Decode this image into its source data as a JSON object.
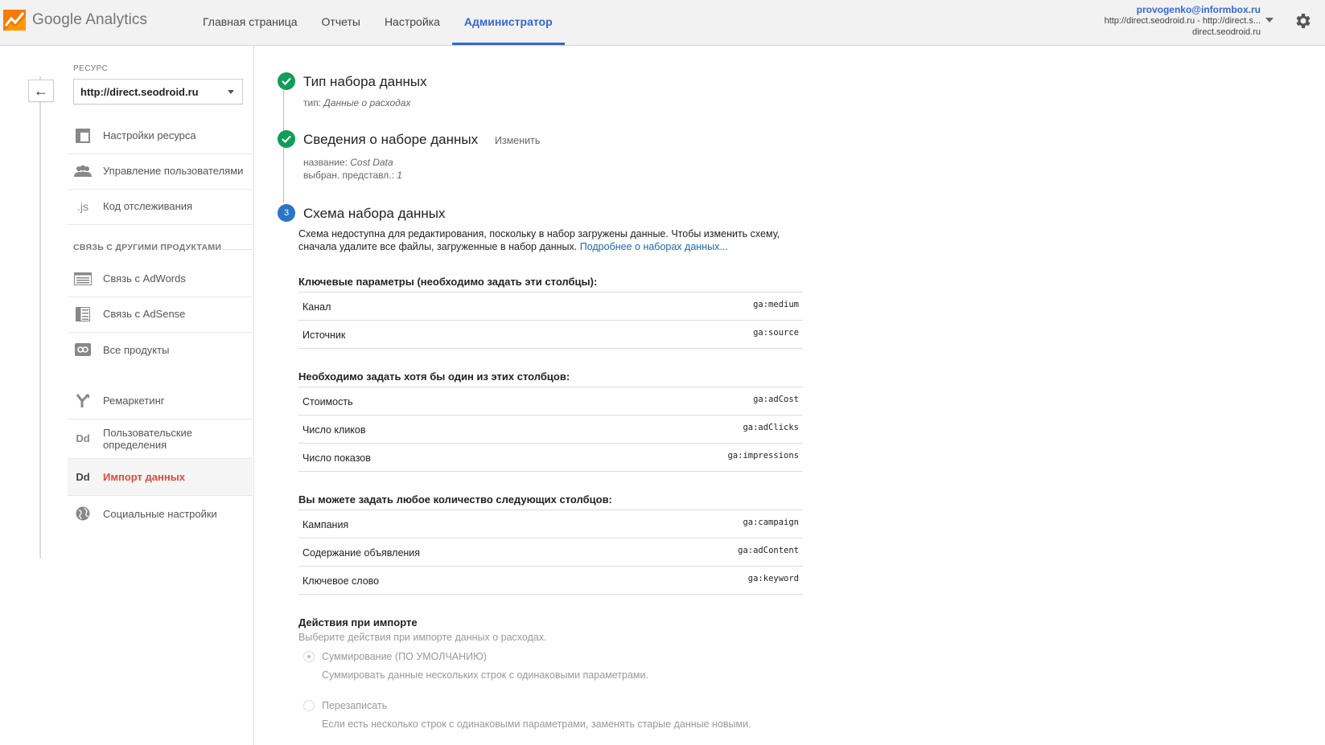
{
  "header": {
    "logo_text": "Google Analytics",
    "nav": [
      {
        "label": "Главная страница",
        "active": false
      },
      {
        "label": "Отчеты",
        "active": false
      },
      {
        "label": "Настройка",
        "active": false
      },
      {
        "label": "Администратор",
        "active": true
      }
    ],
    "account": {
      "email": "provogenko@informbox.ru",
      "property_line": "http://direct.seodroid.ru - http://direct.s...",
      "view_line": "direct.seodroid.ru"
    }
  },
  "sidebar": {
    "resource_label": "РЕСУРС",
    "resource_value": "http://direct.seodroid.ru",
    "items": [
      {
        "label": "Настройки ресурса",
        "icon": "property-settings-icon"
      },
      {
        "label": "Управление пользователями",
        "icon": "users-icon"
      },
      {
        "label": "Код отслеживания",
        "icon": "js-icon"
      }
    ],
    "section_label": "СВЯЗЬ С ДРУГИМИ ПРОДУКТАМИ",
    "product_items": [
      {
        "label": "Связь с AdWords",
        "icon": "adwords-icon"
      },
      {
        "label": "Связь с AdSense",
        "icon": "adsense-icon"
      },
      {
        "label": "Все продукты",
        "icon": "all-products-icon"
      }
    ],
    "other_items": [
      {
        "label": "Ремаркетинг",
        "icon": "remarketing-icon"
      },
      {
        "label": "Пользовательские определения",
        "icon": "custom-definitions-icon",
        "icon_text": "Dd"
      },
      {
        "label": "Импорт данных",
        "icon": "data-import-icon",
        "icon_text": "Dd",
        "active": true
      },
      {
        "label": "Социальные настройки",
        "icon": "social-icon"
      }
    ]
  },
  "steps": [
    {
      "number": "1",
      "title": "Тип набора данных",
      "sub_label": "тип:",
      "sub_value": "Данные о расходах",
      "status": "done"
    },
    {
      "number": "2",
      "title": "Сведения о наборе данных",
      "change_label": "Изменить",
      "name_label": "название:",
      "name_value": "Cost Data",
      "views_label": "выбран. представл.:",
      "views_value": "1",
      "status": "done"
    },
    {
      "number": "3",
      "title": "Схема набора данных",
      "status": "current"
    }
  ],
  "schema": {
    "description": "Схема недоступна для редактирования, поскольку в набор загружены данные. Чтобы изменить схему, сначала удалите все файлы, загруженные в набор данных.",
    "learn_more": "Подробнее о наборах данных...",
    "key_title": "Ключевые параметры (необходимо задать эти столбцы):",
    "key_rows": [
      {
        "name": "Канал",
        "code": "ga:medium"
      },
      {
        "name": "Источник",
        "code": "ga:source"
      }
    ],
    "atleast_title": "Необходимо задать хотя бы один из этих столбцов:",
    "atleast_rows": [
      {
        "name": "Стоимость",
        "code": "ga:adCost"
      },
      {
        "name": "Число кликов",
        "code": "ga:adClicks"
      },
      {
        "name": "Число показов",
        "code": "ga:impressions"
      }
    ],
    "any_title": "Вы можете задать любое количество следующих столбцов:",
    "any_rows": [
      {
        "name": "Кампания",
        "code": "ga:campaign"
      },
      {
        "name": "Содержание объявления",
        "code": "ga:adContent"
      },
      {
        "name": "Ключевое слово",
        "code": "ga:keyword"
      }
    ],
    "import_title": "Действия при импорте",
    "import_sub": "Выберите действия при импорте данных о расходах.",
    "options": [
      {
        "label": "Суммирование (ПО УМОЛЧАНИЮ)",
        "desc": "Суммировать данные нескольких строк с одинаковыми параметрами.",
        "checked": true
      },
      {
        "label": "Перезаписать",
        "desc": "Если есть несколько строк с одинаковыми параметрами, заменять старые данные новыми.",
        "checked": false
      }
    ]
  },
  "colors": {
    "accent": "#3367d6",
    "done": "#0f9d58",
    "current": "#2a75c6",
    "active_item": "#dd4b39",
    "link": "#1c67b3"
  }
}
